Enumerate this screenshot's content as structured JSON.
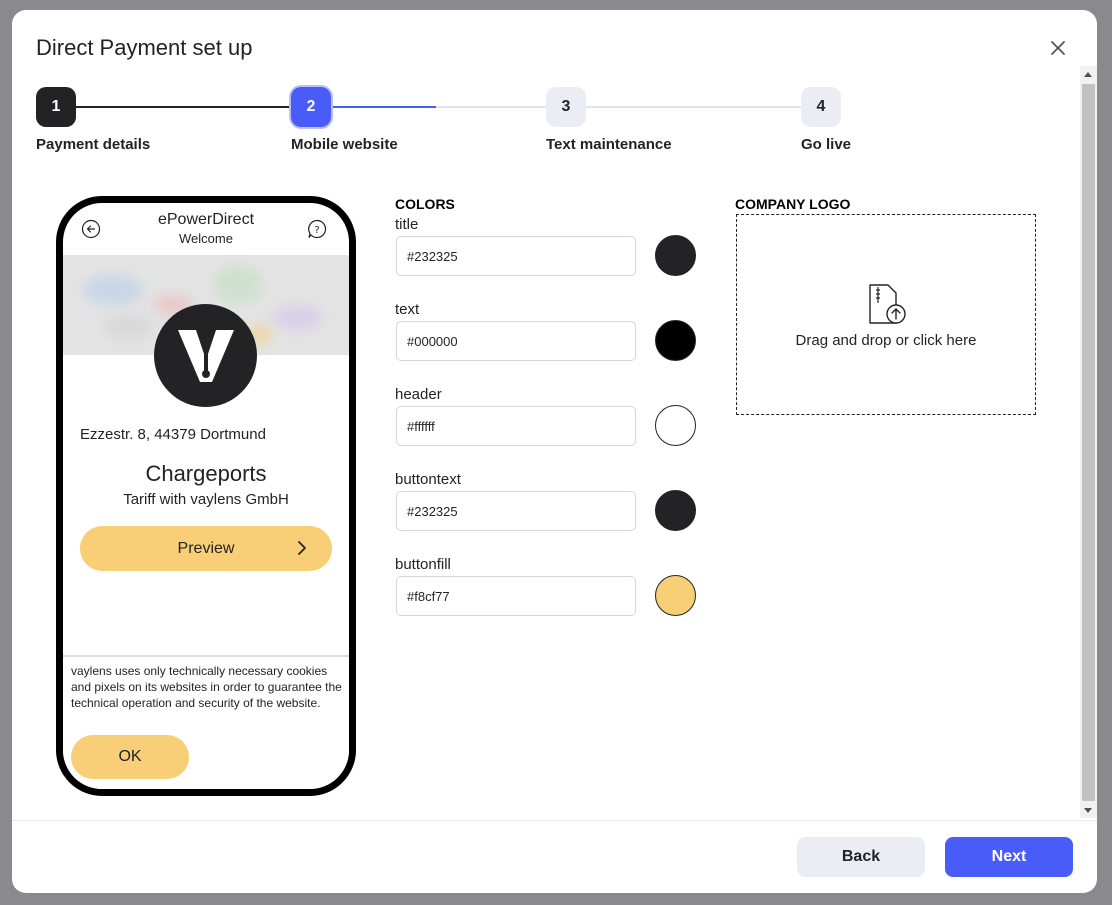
{
  "modal": {
    "title": "Direct Payment set up"
  },
  "steps": [
    {
      "number": "1",
      "label": "Payment details",
      "state": "done"
    },
    {
      "number": "2",
      "label": "Mobile website",
      "state": "active"
    },
    {
      "number": "3",
      "label": "Text maintenance",
      "state": "pending"
    },
    {
      "number": "4",
      "label": "Go live",
      "state": "pending"
    }
  ],
  "phone": {
    "title": "ePowerDirect",
    "subtitle": "Welcome",
    "address": "Ezzestr. 8, 44379 Dortmund",
    "name": "Chargeports",
    "tariff": "Tariff with vaylens GmbH",
    "preview_label": "Preview",
    "cookie_text": "vaylens uses only technically necessary cookies and pixels on its websites in order to guarantee the technical operation and security of the website.",
    "cookie_ok": "OK"
  },
  "colors": {
    "heading": "COLORS",
    "fields": [
      {
        "label": "title",
        "value": "#232325",
        "swatch": "#232325"
      },
      {
        "label": "text",
        "value": "#000000",
        "swatch": "#000000"
      },
      {
        "label": "header",
        "value": "#ffffff",
        "swatch": "#ffffff"
      },
      {
        "label": "buttontext",
        "value": "#232325",
        "swatch": "#232325"
      },
      {
        "label": "buttonfill",
        "value": "#f8cf77",
        "swatch": "#f8cf77"
      }
    ]
  },
  "logo": {
    "heading": "COMPANY LOGO",
    "dropzone_text": "Drag and drop or click here"
  },
  "footer": {
    "back_label": "Back",
    "next_label": "Next"
  },
  "theme": {
    "accent": "#4a5cf7",
    "dark": "#232325",
    "pending_step_bg": "#ececf4"
  }
}
